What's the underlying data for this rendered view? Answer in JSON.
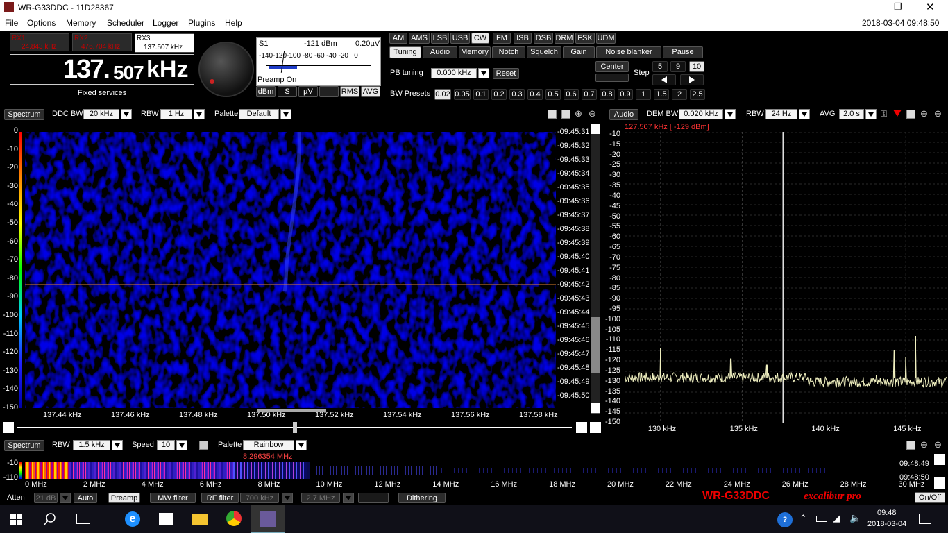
{
  "window": {
    "title": "WR-G33DDC - 11D28367",
    "datetime": "2018-03-04 09:48:50"
  },
  "menu": [
    "File",
    "Options",
    "Memory",
    "Scheduler",
    "Logger",
    "Plugins",
    "Help"
  ],
  "rx": [
    {
      "name": "RX1",
      "freq": "24.843 kHz"
    },
    {
      "name": "RX2",
      "freq": "476.704 kHz"
    },
    {
      "name": "RX3",
      "freq": "137.507 kHz"
    }
  ],
  "main_freq": {
    "big": "137.",
    "small": "507",
    "unit": "kHz"
  },
  "service": "Fixed services",
  "smeter": {
    "s": "S1",
    "dbm": "-121 dBm",
    "uv": "0.20µV",
    "scale": "-140-120-100 -80 -60 -40 -20   0",
    "preamp": "Preamp On",
    "units": [
      "dBm",
      "S",
      "µV"
    ],
    "modes2": [
      "RMS",
      "AVG"
    ]
  },
  "modes": [
    "AM",
    "AMS",
    "LSB",
    "USB",
    "CW",
    "FM",
    "ISB",
    "DSB",
    "DRM",
    "FSK",
    "UDM"
  ],
  "active_mode": "CW",
  "tabs": [
    "Tuning",
    "Audio",
    "Memory",
    "Notch",
    "Squelch",
    "Gain",
    "Noise blanker",
    "Pause"
  ],
  "pb": {
    "label": "PB tuning",
    "value": "0.000 kHz",
    "reset": "Reset",
    "center": "Center",
    "step_label": "Step",
    "steps": [
      "5",
      "9",
      "10"
    ]
  },
  "bw": {
    "label": "BW Presets",
    "values": [
      "0.02",
      "0.05",
      "0.1",
      "0.2",
      "0.3",
      "0.4",
      "0.5",
      "0.6",
      "0.7",
      "0.8",
      "0.9",
      "1",
      "1.5",
      "2",
      "2.5"
    ]
  },
  "spectrum": {
    "tab": "Spectrum",
    "ddc_label": "DDC BW",
    "ddc": "20 kHz",
    "rbw_label": "RBW",
    "rbw": "1 Hz",
    "pal_label": "Palette",
    "pal": "Default",
    "y": [
      "0",
      "-10",
      "-20",
      "-30",
      "-40",
      "-50",
      "-60",
      "-70",
      "-80",
      "-90",
      "-100",
      "-110",
      "-120",
      "-130",
      "-140",
      "-150"
    ],
    "x": [
      "137.44 kHz",
      "137.46 kHz",
      "137.48 kHz",
      "137.50 kHz",
      "137.52 kHz",
      "137.54 kHz",
      "137.56 kHz",
      "137.58 kHz"
    ],
    "times": [
      "09:45:31",
      "09:45:32",
      "09:45:33",
      "09:45:34",
      "09:45:35",
      "09:45:36",
      "09:45:37",
      "09:45:38",
      "09:45:39",
      "09:45:40",
      "09:45:41",
      "09:45:42",
      "09:45:43",
      "09:45:44",
      "09:45:45",
      "09:45:46",
      "09:45:47",
      "09:45:48",
      "09:45:49",
      "09:45:50"
    ]
  },
  "audio": {
    "tab": "Audio",
    "dem_label": "DEM BW",
    "dem": "0.020 kHz",
    "rbw_label": "RBW",
    "rbw": "24 Hz",
    "avg_label": "AVG",
    "avg": "2.0 s",
    "readout": "127.507 kHz [ -129 dBm]",
    "y": [
      "-10",
      "-15",
      "-20",
      "-25",
      "-30",
      "-35",
      "-40",
      "-45",
      "-50",
      "-55",
      "-60",
      "-65",
      "-70",
      "-75",
      "-80",
      "-85",
      "-90",
      "-95",
      "-100",
      "-105",
      "-110",
      "-115",
      "-120",
      "-125",
      "-130",
      "-135",
      "-140",
      "-145",
      "-150"
    ],
    "x": [
      "130 kHz",
      "135 kHz",
      "140 kHz",
      "145 kHz"
    ]
  },
  "chart_data": {
    "type": "line",
    "xlabel": "",
    "ylabel": "",
    "ylim": [
      -150,
      -10
    ],
    "xlim": [
      127.8,
      147.5
    ],
    "peaks": [
      [
        130.0,
        -114
      ],
      [
        134.3,
        -119
      ],
      [
        136.5,
        -122
      ],
      [
        139.2,
        -130
      ],
      [
        140.8,
        -129
      ],
      [
        143.2,
        -127
      ],
      [
        144.3,
        -115
      ],
      [
        145.0,
        -118
      ],
      [
        145.6,
        -108
      ]
    ],
    "noise_floor": -128,
    "marker_x": 137.5
  },
  "wideband": {
    "tab": "Spectrum",
    "rbw_label": "RBW",
    "rbw": "1.5 kHz",
    "speed_label": "Speed",
    "speed": "10",
    "pal_label": "Palette",
    "pal": "Rainbow",
    "marker": "8.296354 MHz",
    "y": [
      "-10",
      "-110"
    ],
    "x": [
      "0 MHz",
      "2 MHz",
      "4 MHz",
      "6 MHz",
      "8 MHz",
      "10 MHz",
      "12 MHz",
      "14 MHz",
      "16 MHz",
      "18 MHz",
      "20 MHz",
      "22 MHz",
      "24 MHz",
      "26 MHz",
      "28 MHz",
      "30 MHz"
    ],
    "times": [
      "09:48:49",
      "09:48:50"
    ]
  },
  "bottom": {
    "atten": "Atten",
    "atten_val": "21 dB",
    "auto": "Auto",
    "preamp": "Preamp",
    "mw": "MW filter",
    "rf": "RF filter",
    "rf_val": "700 kHz",
    "rf_val2": "2.7 MHz",
    "dither": "Dithering",
    "brand": "WR-G33DDC",
    "brand2": "excalibur pro",
    "onoff": "On/Off"
  },
  "taskbar": {
    "time": "09:48",
    "date": "2018-03-04"
  }
}
